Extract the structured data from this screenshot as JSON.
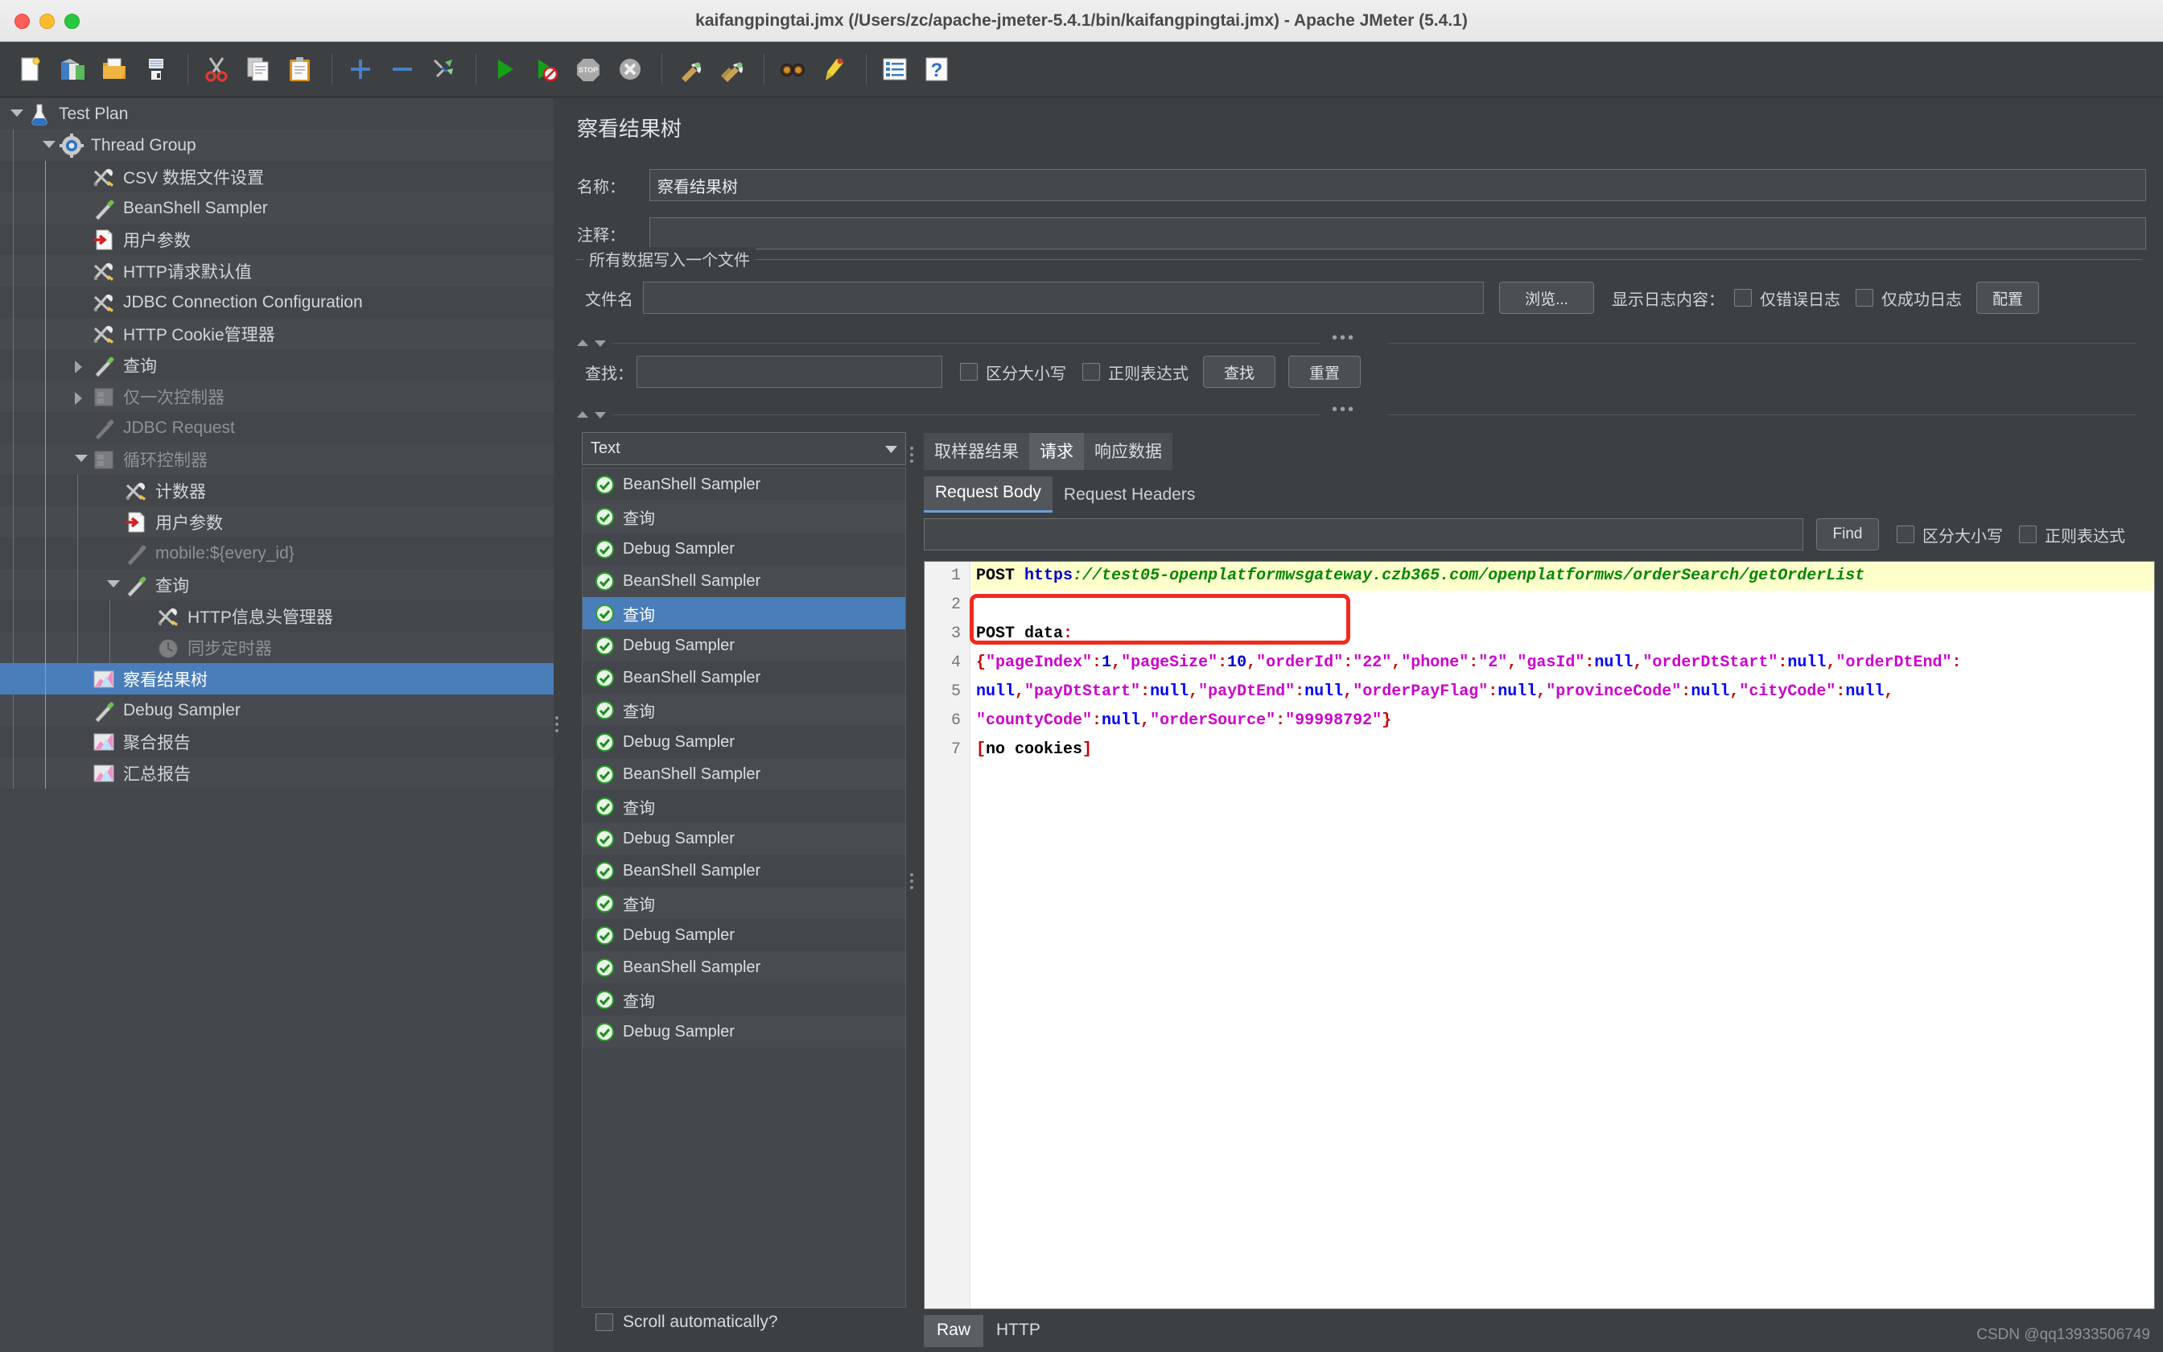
{
  "window": {
    "title": "kaifangpingtai.jmx (/Users/zc/apache-jmeter-5.4.1/bin/kaifangpingtai.jmx) - Apache JMeter (5.4.1)"
  },
  "toolbar": {
    "buttons": [
      {
        "name": "new-file-icon",
        "label": "New"
      },
      {
        "name": "templates-icon",
        "label": "Templates"
      },
      {
        "name": "open-icon",
        "label": "Open"
      },
      {
        "name": "save-icon",
        "label": "Save"
      },
      {
        "name": "cut-icon",
        "label": "Cut"
      },
      {
        "name": "copy-icon",
        "label": "Copy"
      },
      {
        "name": "paste-icon",
        "label": "Paste"
      },
      {
        "name": "expand-all-icon",
        "label": "Expand"
      },
      {
        "name": "collapse-all-icon",
        "label": "Collapse"
      },
      {
        "name": "toggle-icon",
        "label": "Toggle"
      },
      {
        "name": "start-icon",
        "label": "Start"
      },
      {
        "name": "start-no-pauses-icon",
        "label": "Start no pauses"
      },
      {
        "name": "stop-icon",
        "label": "Stop"
      },
      {
        "name": "shutdown-icon",
        "label": "Shutdown"
      },
      {
        "name": "clear-icon",
        "label": "Clear"
      },
      {
        "name": "clear-all-icon",
        "label": "Clear All"
      },
      {
        "name": "search-icon",
        "label": "Search"
      },
      {
        "name": "reset-search-icon",
        "label": "Reset Search"
      },
      {
        "name": "function-helper-icon",
        "label": "Function Helper"
      },
      {
        "name": "help-icon",
        "label": "Help"
      }
    ]
  },
  "tree": {
    "items": [
      {
        "label": "Test Plan",
        "depth": 0,
        "icon": "flask-icon",
        "toggle": "down",
        "disabled": false,
        "selected": false
      },
      {
        "label": "Thread Group",
        "depth": 1,
        "icon": "gear-icon",
        "toggle": "down",
        "disabled": false,
        "selected": false
      },
      {
        "label": "CSV 数据文件设置",
        "depth": 2,
        "icon": "config-icon",
        "toggle": "none",
        "disabled": false,
        "selected": false
      },
      {
        "label": "BeanShell Sampler",
        "depth": 2,
        "icon": "sampler-icon",
        "toggle": "none",
        "disabled": false,
        "selected": false
      },
      {
        "label": "用户参数",
        "depth": 2,
        "icon": "userparams-icon",
        "toggle": "none",
        "disabled": false,
        "selected": false
      },
      {
        "label": "HTTP请求默认值",
        "depth": 2,
        "icon": "config-icon",
        "toggle": "none",
        "disabled": false,
        "selected": false
      },
      {
        "label": "JDBC Connection Configuration",
        "depth": 2,
        "icon": "config-icon",
        "toggle": "none",
        "disabled": false,
        "selected": false
      },
      {
        "label": "HTTP Cookie管理器",
        "depth": 2,
        "icon": "config-icon",
        "toggle": "none",
        "disabled": false,
        "selected": false
      },
      {
        "label": "查询",
        "depth": 2,
        "icon": "sampler-icon",
        "toggle": "right",
        "disabled": false,
        "selected": false
      },
      {
        "label": "仅一次控制器",
        "depth": 2,
        "icon": "controller-icon",
        "toggle": "right",
        "disabled": true,
        "selected": false
      },
      {
        "label": "JDBC Request",
        "depth": 2,
        "icon": "sampler-gray-icon",
        "toggle": "none",
        "disabled": true,
        "selected": false
      },
      {
        "label": "循环控制器",
        "depth": 2,
        "icon": "controller-icon",
        "toggle": "down",
        "disabled": true,
        "selected": false
      },
      {
        "label": "计数器",
        "depth": 3,
        "icon": "config-icon",
        "toggle": "none",
        "disabled": false,
        "selected": false
      },
      {
        "label": "用户参数",
        "depth": 3,
        "icon": "userparams-icon",
        "toggle": "none",
        "disabled": false,
        "selected": false
      },
      {
        "label": "mobile:${every_id}",
        "depth": 3,
        "icon": "sampler-gray-icon",
        "toggle": "none",
        "disabled": true,
        "selected": false
      },
      {
        "label": "查询",
        "depth": 3,
        "icon": "sampler-icon",
        "toggle": "down",
        "disabled": false,
        "selected": false
      },
      {
        "label": "HTTP信息头管理器",
        "depth": 4,
        "icon": "config-icon",
        "toggle": "none",
        "disabled": false,
        "selected": false
      },
      {
        "label": "同步定时器",
        "depth": 4,
        "icon": "timer-icon",
        "toggle": "none",
        "disabled": true,
        "selected": false
      },
      {
        "label": "察看结果树",
        "depth": 2,
        "icon": "listener-icon",
        "toggle": "none",
        "disabled": false,
        "selected": true
      },
      {
        "label": "Debug Sampler",
        "depth": 2,
        "icon": "sampler-icon",
        "toggle": "none",
        "disabled": false,
        "selected": false
      },
      {
        "label": "聚合报告",
        "depth": 2,
        "icon": "listener-icon",
        "toggle": "none",
        "disabled": false,
        "selected": false
      },
      {
        "label": "汇总报告",
        "depth": 2,
        "icon": "listener-icon",
        "toggle": "none",
        "disabled": false,
        "selected": false
      }
    ]
  },
  "panel": {
    "title": "察看结果树",
    "name_label": "名称：",
    "name_value": "察看结果树",
    "comment_label": "注释：",
    "comment_value": "",
    "group_title": "所有数据写入一个文件",
    "filename_label": "文件名",
    "filename_value": "",
    "browse_button": "浏览...",
    "log_display_label": "显示日志内容：",
    "errors_only_label": "仅错误日志",
    "success_only_label": "仅成功日志",
    "configure_button": "配置",
    "search_label": "查找：",
    "search_value": "",
    "case_sensitive_label": "区分大小写",
    "regex_label": "正则表达式",
    "find_button": "查找",
    "reset_button": "重置"
  },
  "results": {
    "renderer_selected": "Text",
    "scroll_auto_label": "Scroll automatically?",
    "rows": [
      {
        "label": "BeanShell Sampler",
        "status": "ok",
        "selected": false
      },
      {
        "label": "查询",
        "status": "ok",
        "selected": false
      },
      {
        "label": "Debug Sampler",
        "status": "ok",
        "selected": false
      },
      {
        "label": "BeanShell Sampler",
        "status": "ok",
        "selected": false
      },
      {
        "label": "查询",
        "status": "ok",
        "selected": true
      },
      {
        "label": "Debug Sampler",
        "status": "ok",
        "selected": false
      },
      {
        "label": "BeanShell Sampler",
        "status": "ok",
        "selected": false
      },
      {
        "label": "查询",
        "status": "ok",
        "selected": false
      },
      {
        "label": "Debug Sampler",
        "status": "ok",
        "selected": false
      },
      {
        "label": "BeanShell Sampler",
        "status": "ok",
        "selected": false
      },
      {
        "label": "查询",
        "status": "ok",
        "selected": false
      },
      {
        "label": "Debug Sampler",
        "status": "ok",
        "selected": false
      },
      {
        "label": "BeanShell Sampler",
        "status": "ok",
        "selected": false
      },
      {
        "label": "查询",
        "status": "ok",
        "selected": false
      },
      {
        "label": "Debug Sampler",
        "status": "ok",
        "selected": false
      },
      {
        "label": "BeanShell Sampler",
        "status": "ok",
        "selected": false
      },
      {
        "label": "查询",
        "status": "ok",
        "selected": false
      },
      {
        "label": "Debug Sampler",
        "status": "ok",
        "selected": false
      }
    ]
  },
  "detail": {
    "tabs": [
      {
        "label": "取样器结果",
        "active": false
      },
      {
        "label": "请求",
        "active": true
      },
      {
        "label": "响应数据",
        "active": false
      }
    ],
    "subtabs": [
      {
        "label": "Request Body",
        "active": true
      },
      {
        "label": "Request Headers",
        "active": false
      }
    ],
    "find_value": "",
    "find_button": "Find",
    "case_sensitive_label": "区分大小写",
    "regex_label": "正则表达式",
    "bottom_tabs": [
      {
        "label": "Raw",
        "active": true
      },
      {
        "label": "HTTP",
        "active": false
      }
    ],
    "code": {
      "line_numbers": [
        "1",
        "2",
        "3",
        "4",
        "5",
        "6",
        "7"
      ],
      "request_method": "POST",
      "request_scheme": "https",
      "request_url": "://test05-openplatformwsgateway.czb365.com/openplatformws/orderSearch/getOrderList",
      "post_data_label": "POST data",
      "body_line1": "{\"pageIndex\":1,\"pageSize\":10,\"orderId\":\"22\",\"phone\":\"2\",\"gasId\":null,\"orderDtStart\":null,\"orderDtEnd\":",
      "body_line2": "null,\"payDtStart\":null,\"payDtEnd\":null,\"orderPayFlag\":null,\"provinceCode\":null,\"cityCode\":null,",
      "body_line3": "\"countyCode\":null,\"orderSource\":\"99998792\"}",
      "cookies_line": "[no cookies]"
    }
  },
  "watermark": "CSDN @qq13933506749"
}
